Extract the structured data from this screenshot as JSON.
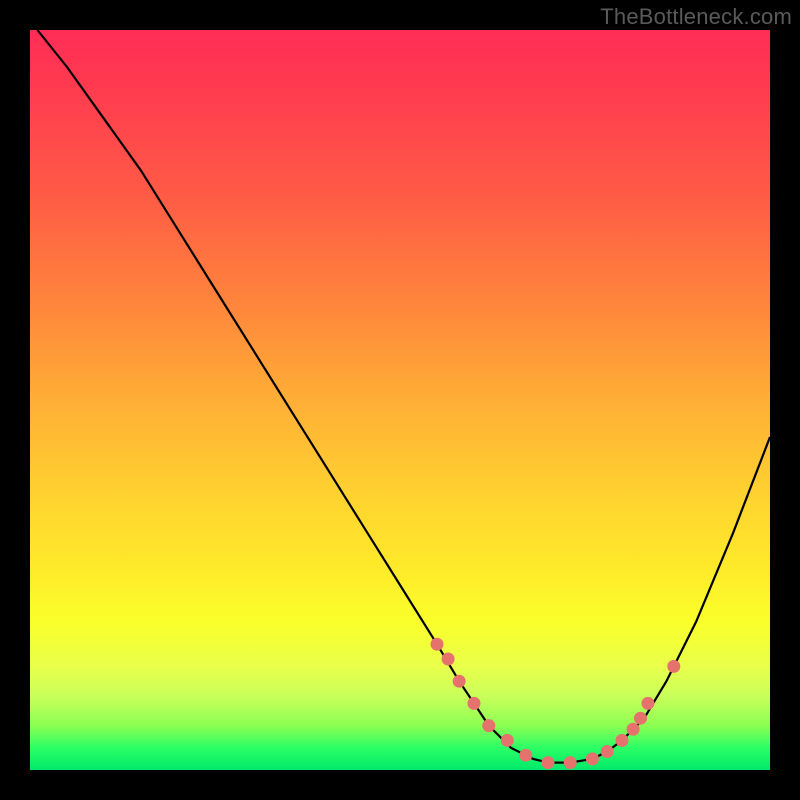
{
  "watermark": "TheBottleneck.com",
  "colors": {
    "marker": "#e6726e",
    "curve": "#000000"
  },
  "chart_data": {
    "type": "line",
    "title": "",
    "xlabel": "",
    "ylabel": "",
    "xlim": [
      0,
      100
    ],
    "ylim": [
      0,
      100
    ],
    "grid": false,
    "curve_x": [
      1,
      5,
      10,
      15,
      20,
      25,
      30,
      35,
      40,
      45,
      50,
      55,
      58,
      60,
      62,
      65,
      68,
      70,
      73,
      76,
      78,
      80,
      83,
      86,
      90,
      95,
      100
    ],
    "curve_y": [
      100,
      95,
      88,
      81,
      73,
      65,
      57,
      49,
      41,
      33,
      25,
      17,
      12,
      9,
      6,
      3,
      1.5,
      1,
      1,
      1.5,
      2.5,
      4,
      7,
      12,
      20,
      32,
      45
    ],
    "markers_x": [
      55,
      56.5,
      58,
      60,
      62,
      64.5,
      67,
      70,
      73,
      76,
      78,
      80,
      81.5,
      82.5,
      83.5,
      87
    ],
    "markers_y": [
      17,
      15,
      12,
      9,
      6,
      4,
      2,
      1,
      1,
      1.5,
      2.5,
      4,
      5.5,
      7,
      9,
      14
    ]
  }
}
